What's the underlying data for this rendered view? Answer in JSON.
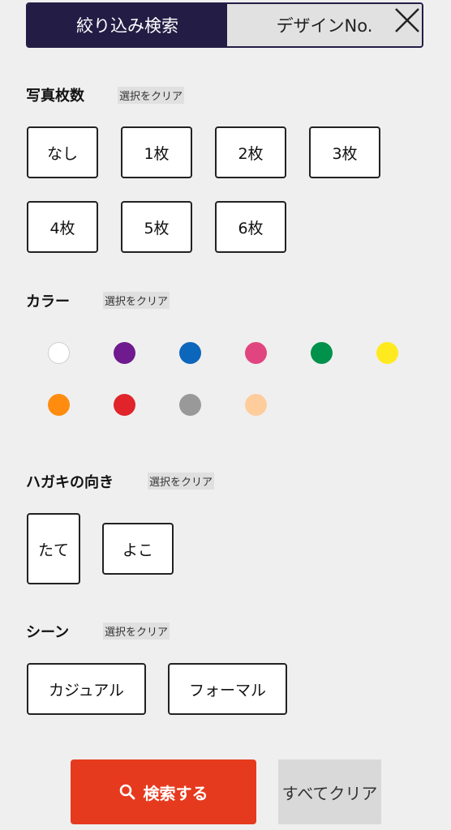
{
  "tabs": {
    "filter": "絞り込み検索",
    "design_no": "デザインNo."
  },
  "icons": {
    "close": "close-icon",
    "search": "search-icon"
  },
  "photo_count": {
    "title": "写真枚数",
    "clear": "選択をクリア",
    "options": [
      "なし",
      "1枚",
      "2枚",
      "3枚",
      "4枚",
      "5枚",
      "6枚"
    ]
  },
  "color": {
    "title": "カラー",
    "clear": "選択をクリア",
    "swatches": [
      "#ffffff",
      "#6f1a8f",
      "#0c66bb",
      "#e1457f",
      "#00914a",
      "#ffea1f",
      "#ff8c0f",
      "#e0242a",
      "#999999",
      "#ffcc9c"
    ]
  },
  "orientation": {
    "title": "ハガキの向き",
    "clear": "選択をクリア",
    "options": [
      "たて",
      "よこ"
    ]
  },
  "scene": {
    "title": "シーン",
    "clear": "選択をクリア",
    "options": [
      "カジュアル",
      "フォーマル"
    ]
  },
  "actions": {
    "search": "検索する",
    "clear_all": "すべてクリア",
    "accent": "#e63a1e"
  }
}
